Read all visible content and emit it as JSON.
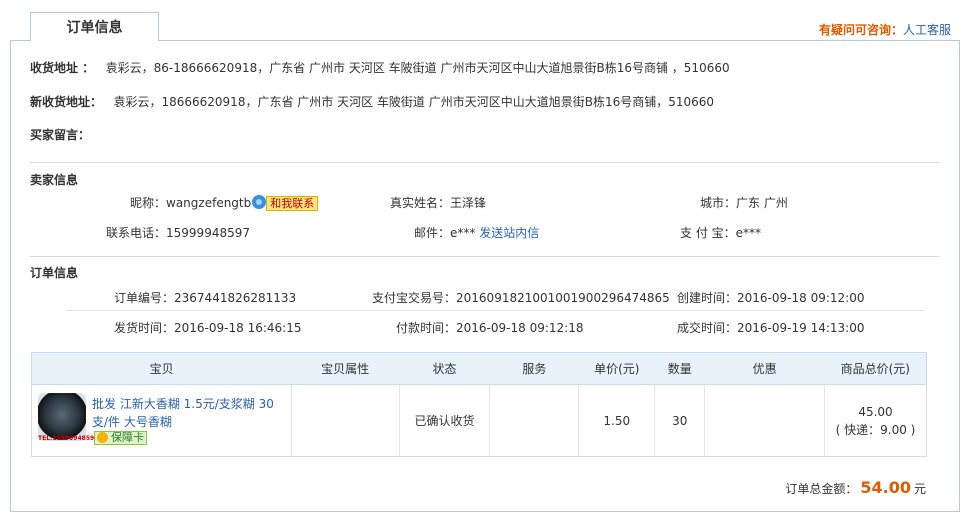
{
  "tab": {
    "title": "订单信息"
  },
  "help": {
    "question": "有疑问可咨询：",
    "link": "人工客服"
  },
  "address": {
    "old_label": "收货地址 ：",
    "old_value": "袁彩云，86-18666620918，广东省 广州市 天河区 车陂街道 广州市天河区中山大道旭景街B栋16号商铺 ，510660",
    "new_label": "新收货地址：",
    "new_value": "袁彩云，18666620918，广东省 广州市 天河区 车陂街道 广州市天河区中山大道旭景街B栋16号商铺，510660",
    "message_label": "买家留言："
  },
  "seller": {
    "section_title": "卖家信息",
    "nickname_label": "昵称：",
    "nickname": "wangzefengtb",
    "contact_button": "和我联系",
    "real_name_label": "真实姓名：",
    "real_name": "王泽锋",
    "city_label": "城市：",
    "city": "广东 广州",
    "phone_label": "联系电话：",
    "phone": "15999948597",
    "email_label": "邮件：",
    "email": "e***",
    "send_msg": "发送站内信",
    "alipay_label": "支 付 宝：",
    "alipay": "e***"
  },
  "order": {
    "section_title": "订单信息",
    "number_label": "订单编号：",
    "number": "2367441826281133",
    "alipay_trade_label": "支付宝交易号：",
    "alipay_trade": "2016091821001001900296474865",
    "created_label": "创建时间：",
    "created": "2016-09-18 09:12:00",
    "shipped_label": "发货时间：",
    "shipped": "2016-09-18 16:46:15",
    "paid_label": "付款时间：",
    "paid": "2016-09-18 09:12:18",
    "deal_label": "成交时间：",
    "deal": "2016-09-19 14:13:00"
  },
  "table": {
    "headers": [
      "宝贝",
      "宝贝属性",
      "状态",
      "服务",
      "单价(元)",
      "数量",
      "优惠",
      "商品总价(元)"
    ],
    "row": {
      "name": "批发 江新大香糊 1.5元/支浆糊 30支/件 大号香糊",
      "thumb_caption": "TEL:15999948597",
      "badge": "保障卡",
      "attributes": "",
      "status": "已确认收货",
      "service": "",
      "unit_price": "1.50",
      "quantity": "30",
      "discount": "",
      "total": "45.00",
      "shipping": "( 快递：9.00 )"
    }
  },
  "summary": {
    "label": "订单总金额：",
    "amount": "54.00",
    "unit": "元"
  }
}
